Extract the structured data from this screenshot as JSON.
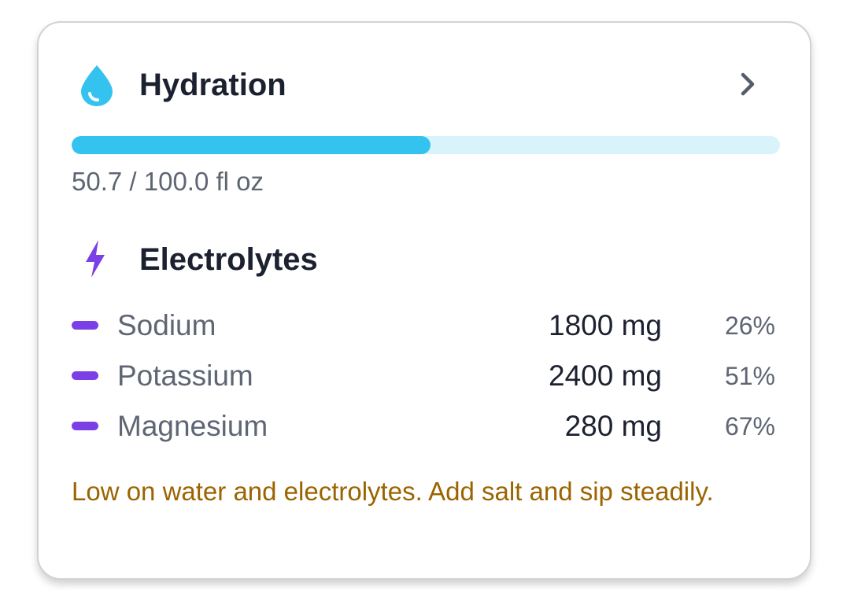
{
  "hydration": {
    "title": "Hydration",
    "icon": "water-drop-icon",
    "accent_color": "#34c3ee",
    "track_color": "#d9f3fa",
    "current": 50.7,
    "goal": 100.0,
    "progress_fraction": 0.507,
    "progress_label": "50.7 / 100.0 fl oz",
    "chevron_icon": "chevron-right-icon"
  },
  "electrolytes": {
    "title": "Electrolytes",
    "icon": "lightning-bolt-icon",
    "accent_color": "#7b3fe6",
    "items": [
      {
        "name": "Sodium",
        "amount": "1800 mg",
        "percent": "26%"
      },
      {
        "name": "Potassium",
        "amount": "2400 mg",
        "percent": "51%"
      },
      {
        "name": "Magnesium",
        "amount": "280 mg",
        "percent": "67%"
      }
    ]
  },
  "message": {
    "text": "Low on water and electrolytes. Add salt and sip steadily.",
    "color": "#9b6400"
  }
}
